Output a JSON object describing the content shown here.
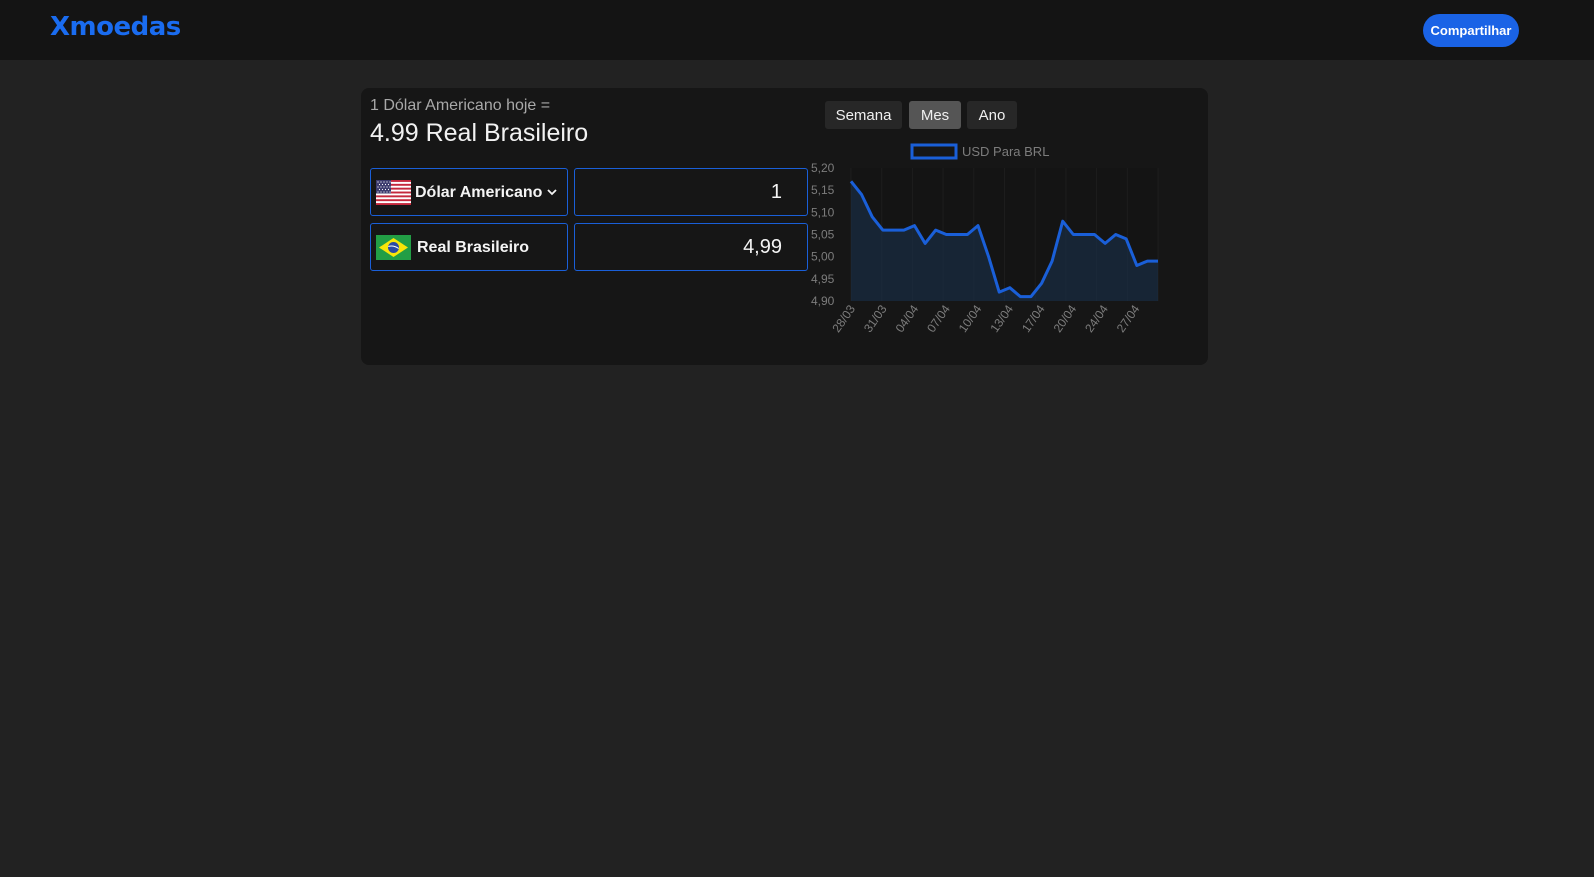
{
  "header": {
    "logo": "Xmoedas",
    "share_label": "Compartilhar"
  },
  "converter": {
    "today_label": "1 Dólar Americano hoje =",
    "rate_label": "4.99 Real Brasileiro",
    "from": {
      "currency": "Dólar Americano",
      "amount": "1",
      "flag": "us-flag-icon"
    },
    "to": {
      "currency": "Real Brasileiro",
      "amount": "4,99",
      "flag": "br-flag-icon"
    }
  },
  "period_tabs": [
    {
      "label": "Semana",
      "active": false
    },
    {
      "label": "Mes",
      "active": true
    },
    {
      "label": "Ano",
      "active": false
    }
  ],
  "colors": {
    "accent": "#1a63e6",
    "background": "#222222",
    "card": "#161616",
    "line": "#1a5fd8"
  },
  "chart_data": {
    "type": "area",
    "legend": "USD Para BRL",
    "legend_position": "top",
    "grid": false,
    "x_tick_labels": [
      "28/03",
      "31/03",
      "04/04",
      "07/04",
      "10/04",
      "13/04",
      "17/04",
      "20/04",
      "24/04",
      "27/04"
    ],
    "y_tick_labels": [
      "5,20",
      "5,15",
      "5,10",
      "5,05",
      "5,00",
      "4,95",
      "4,90"
    ],
    "ylim": [
      4.9,
      5.2
    ],
    "series": [
      {
        "name": "USD Para BRL",
        "values": [
          5.17,
          5.14,
          5.09,
          5.06,
          5.06,
          5.06,
          5.07,
          5.03,
          5.06,
          5.05,
          5.05,
          5.05,
          5.07,
          5.0,
          4.92,
          4.93,
          4.91,
          4.91,
          4.94,
          4.99,
          5.08,
          5.05,
          5.05,
          5.05,
          5.03,
          5.05,
          5.04,
          4.98,
          4.99,
          4.99
        ]
      }
    ]
  }
}
